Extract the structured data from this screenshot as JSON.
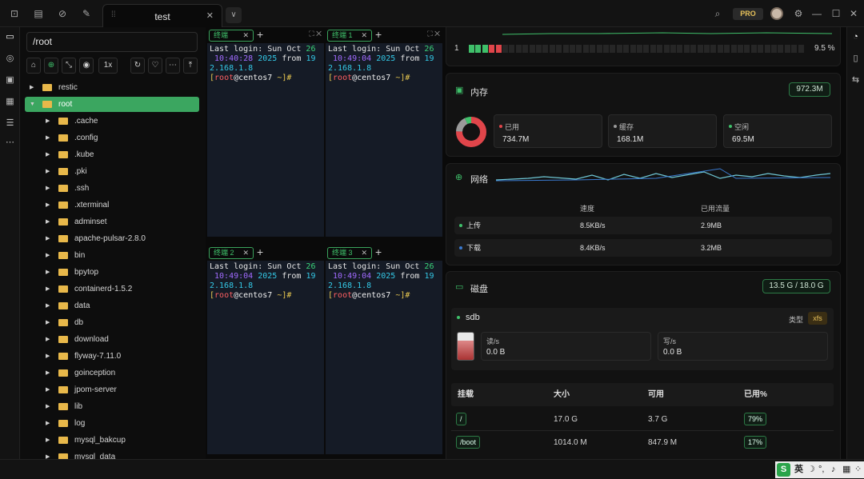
{
  "tab": {
    "title": "test"
  },
  "pro_badge": "PRO",
  "sidebar": {
    "path": "/root",
    "zoom_label": "1x",
    "tree": [
      {
        "label": "restic",
        "depth": 0
      },
      {
        "label": "root",
        "depth": 0,
        "selected": true
      },
      {
        "label": ".cache",
        "depth": 1
      },
      {
        "label": ".config",
        "depth": 1
      },
      {
        "label": ".kube",
        "depth": 1
      },
      {
        "label": ".pki",
        "depth": 1
      },
      {
        "label": ".ssh",
        "depth": 1
      },
      {
        "label": ".xterminal",
        "depth": 1
      },
      {
        "label": "adminset",
        "depth": 1
      },
      {
        "label": "apache-pulsar-2.8.0",
        "depth": 1
      },
      {
        "label": "bin",
        "depth": 1
      },
      {
        "label": "bpytop",
        "depth": 1
      },
      {
        "label": "containerd-1.5.2",
        "depth": 1
      },
      {
        "label": "data",
        "depth": 1
      },
      {
        "label": "db",
        "depth": 1
      },
      {
        "label": "download",
        "depth": 1
      },
      {
        "label": "flyway-7.11.0",
        "depth": 1
      },
      {
        "label": "goinception",
        "depth": 1
      },
      {
        "label": "jpom-server",
        "depth": 1
      },
      {
        "label": "lib",
        "depth": 1
      },
      {
        "label": "log",
        "depth": 1
      },
      {
        "label": "mysql_bakcup",
        "depth": 1
      },
      {
        "label": "mysql_data",
        "depth": 1
      }
    ]
  },
  "terminals": [
    {
      "tab": "终端",
      "line1a": "Last login: Sun Oct ",
      "day": "26",
      "time": " 10:40:28",
      "year": "2025",
      "from": " from ",
      "ip1": "19",
      "ip2": "2.168.1.8",
      "user": "root",
      "host": "centos7",
      "dir": "~"
    },
    {
      "tab": "终端 1",
      "line1a": "Last login: Sun Oct ",
      "day": "26",
      "time": " 10:49:04",
      "year": "2025",
      "from": " from ",
      "ip1": "19",
      "ip2": "2.168.1.8",
      "user": "root",
      "host": "centos7",
      "dir": "~"
    },
    {
      "tab": "终端 2",
      "line1a": "Last login: Sun Oct ",
      "day": "26",
      "time": " 10:49:04",
      "year": "2025",
      "from": " from ",
      "ip1": "19",
      "ip2": "2.168.1.8",
      "user": "root",
      "host": "centos7",
      "dir": "~"
    },
    {
      "tab": "终端 3",
      "line1a": "Last login: Sun Oct ",
      "day": "26",
      "time": " 10:49:04",
      "year": "2025",
      "from": " from ",
      "ip1": "19",
      "ip2": "2.168.1.8",
      "user": "root",
      "host": "centos7",
      "dir": "~"
    }
  ],
  "cpu": {
    "core": "1",
    "usage": "9.5 %",
    "usage_fraction": 0.095
  },
  "memory": {
    "title": "内存",
    "total": "972.3M",
    "used_label": "已用",
    "used": "734.7M",
    "cache_label": "缓存",
    "cache": "168.1M",
    "free_label": "空闲",
    "free": "69.5M"
  },
  "network": {
    "title": "网络",
    "speed_header": "速度",
    "traffic_header": "已用流量",
    "rows": [
      {
        "label": "上传",
        "speed": "8.5KB/s",
        "traffic": "2.9MB"
      },
      {
        "label": "下载",
        "speed": "8.4KB/s",
        "traffic": "3.2MB"
      }
    ]
  },
  "disk": {
    "title": "磁盘",
    "usage": "13.5 G / 18.0 G",
    "device": "sdb",
    "type_label": "类型",
    "type": "xfs",
    "read_label": "读/s",
    "read": "0.0 B",
    "write_label": "写/s",
    "write": "0.0 B",
    "headers": [
      "挂载",
      "大小",
      "可用",
      "已用%"
    ],
    "rows": [
      {
        "mount": "/",
        "size": "17.0 G",
        "avail": "3.7 G",
        "pct": "79%"
      },
      {
        "mount": "/boot",
        "size": "1014.0 M",
        "avail": "847.9 M",
        "pct": "17%"
      }
    ]
  },
  "ime": {
    "lang": "英"
  },
  "colors": {
    "accent": "#3ba660",
    "used": "#e0454a",
    "cache": "#8a8a8a",
    "free": "#3fc06a",
    "upload": "#3fc06a",
    "download": "#3a7ad0"
  }
}
